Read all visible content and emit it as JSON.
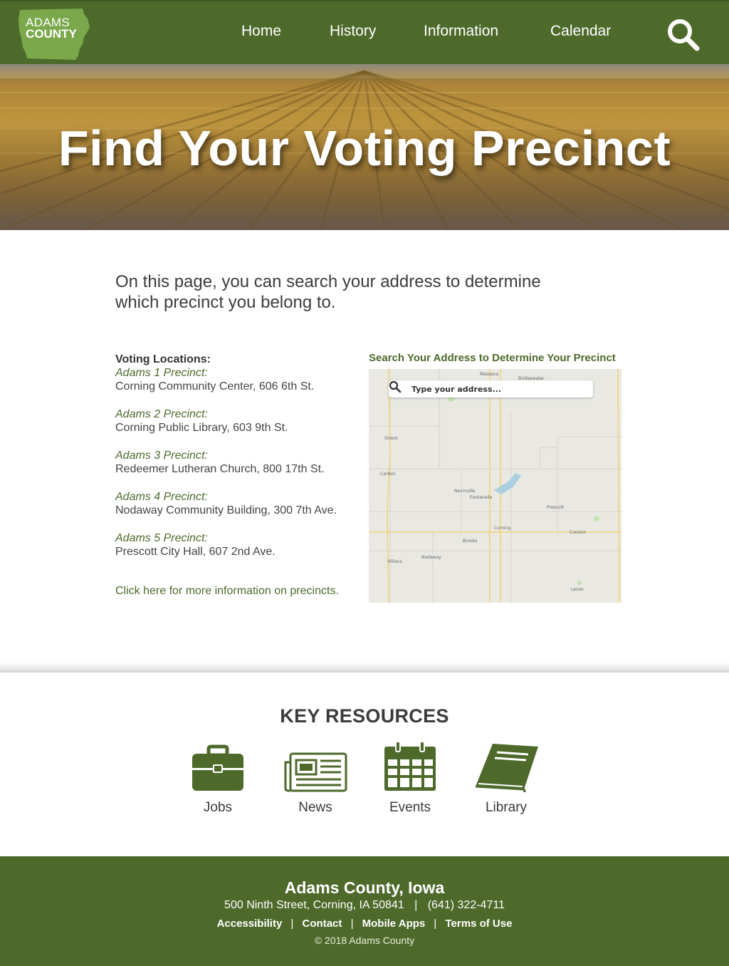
{
  "header": {
    "logo": {
      "line1": "ADAMS",
      "line2": "COUNTY"
    },
    "nav": [
      "Home",
      "History",
      "Information",
      "Calendar"
    ],
    "search_icon": "search-icon"
  },
  "hero": {
    "title": "Find Your Voting Precinct"
  },
  "intro": {
    "text": "On this page, you can search your address to determine which precinct you belong to."
  },
  "locations": {
    "heading": "Voting Locations:",
    "items": [
      {
        "name": "Adams 1 Precinct:",
        "address": "Corning Community Center, 606 6th St."
      },
      {
        "name": "Adams 2 Precinct:",
        "address": "Corning Public Library, 603 9th St."
      },
      {
        "name": "Adams 3 Precinct:",
        "address": "Redeemer Lutheran Church, 800 17th St."
      },
      {
        "name": "Adams 4 Precinct:",
        "address": "Nodaway Community Building, 300 7th Ave."
      },
      {
        "name": "Adams 5 Precinct:",
        "address": "Prescott City Hall, 607 2nd Ave."
      }
    ],
    "more_link": "Click here for more information on precincts."
  },
  "map": {
    "title": "Search Your Address to Determine Your Precinct",
    "search_placeholder": "Type your address...",
    "labels": [
      "Massena",
      "Bridgewater",
      "Orient",
      "Carbon",
      "Nevinville",
      "Fontanelle",
      "Corning",
      "Prescott",
      "Creston",
      "Brooks",
      "Nodaway",
      "Villisca",
      "Lenox"
    ]
  },
  "key_resources": {
    "title": "KEY RESOURCES",
    "items": [
      {
        "label": "Jobs",
        "icon": "briefcase-icon"
      },
      {
        "label": "News",
        "icon": "newspaper-icon"
      },
      {
        "label": "Events",
        "icon": "calendar-icon"
      },
      {
        "label": "Library",
        "icon": "book-icon"
      }
    ]
  },
  "footer": {
    "name": "Adams County, Iowa",
    "address": "500 Ninth Street, Corning, IA 50841",
    "phone": "(641) 322-4711",
    "links": [
      "Accessibility",
      "Contact",
      "Mobile Apps",
      "Terms of Use"
    ],
    "separator": "|",
    "copyright": "© 2018 Adams County"
  },
  "colors": {
    "brand_green": "#4d6a2b",
    "logo_green": "#7aa84a",
    "white": "#ffffff"
  }
}
